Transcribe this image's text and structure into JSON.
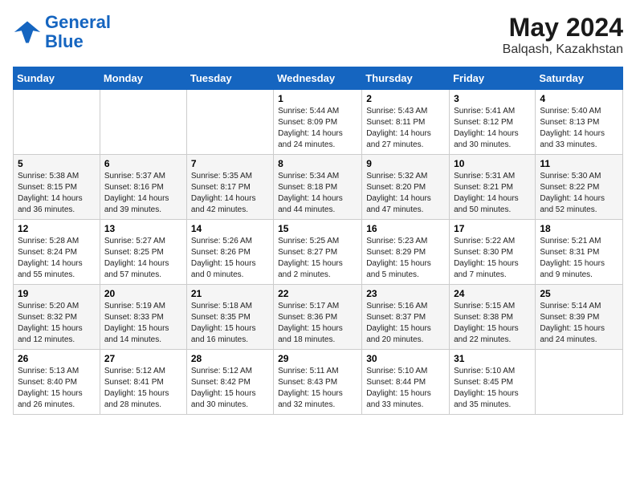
{
  "logo": {
    "line1": "General",
    "line2": "Blue"
  },
  "header": {
    "month_year": "May 2024",
    "location": "Balqash, Kazakhstan"
  },
  "days_of_week": [
    "Sunday",
    "Monday",
    "Tuesday",
    "Wednesday",
    "Thursday",
    "Friday",
    "Saturday"
  ],
  "weeks": [
    [
      {
        "day": "",
        "info": ""
      },
      {
        "day": "",
        "info": ""
      },
      {
        "day": "",
        "info": ""
      },
      {
        "day": "1",
        "info": "Sunrise: 5:44 AM\nSunset: 8:09 PM\nDaylight: 14 hours\nand 24 minutes."
      },
      {
        "day": "2",
        "info": "Sunrise: 5:43 AM\nSunset: 8:11 PM\nDaylight: 14 hours\nand 27 minutes."
      },
      {
        "day": "3",
        "info": "Sunrise: 5:41 AM\nSunset: 8:12 PM\nDaylight: 14 hours\nand 30 minutes."
      },
      {
        "day": "4",
        "info": "Sunrise: 5:40 AM\nSunset: 8:13 PM\nDaylight: 14 hours\nand 33 minutes."
      }
    ],
    [
      {
        "day": "5",
        "info": "Sunrise: 5:38 AM\nSunset: 8:15 PM\nDaylight: 14 hours\nand 36 minutes."
      },
      {
        "day": "6",
        "info": "Sunrise: 5:37 AM\nSunset: 8:16 PM\nDaylight: 14 hours\nand 39 minutes."
      },
      {
        "day": "7",
        "info": "Sunrise: 5:35 AM\nSunset: 8:17 PM\nDaylight: 14 hours\nand 42 minutes."
      },
      {
        "day": "8",
        "info": "Sunrise: 5:34 AM\nSunset: 8:18 PM\nDaylight: 14 hours\nand 44 minutes."
      },
      {
        "day": "9",
        "info": "Sunrise: 5:32 AM\nSunset: 8:20 PM\nDaylight: 14 hours\nand 47 minutes."
      },
      {
        "day": "10",
        "info": "Sunrise: 5:31 AM\nSunset: 8:21 PM\nDaylight: 14 hours\nand 50 minutes."
      },
      {
        "day": "11",
        "info": "Sunrise: 5:30 AM\nSunset: 8:22 PM\nDaylight: 14 hours\nand 52 minutes."
      }
    ],
    [
      {
        "day": "12",
        "info": "Sunrise: 5:28 AM\nSunset: 8:24 PM\nDaylight: 14 hours\nand 55 minutes."
      },
      {
        "day": "13",
        "info": "Sunrise: 5:27 AM\nSunset: 8:25 PM\nDaylight: 14 hours\nand 57 minutes."
      },
      {
        "day": "14",
        "info": "Sunrise: 5:26 AM\nSunset: 8:26 PM\nDaylight: 15 hours\nand 0 minutes."
      },
      {
        "day": "15",
        "info": "Sunrise: 5:25 AM\nSunset: 8:27 PM\nDaylight: 15 hours\nand 2 minutes."
      },
      {
        "day": "16",
        "info": "Sunrise: 5:23 AM\nSunset: 8:29 PM\nDaylight: 15 hours\nand 5 minutes."
      },
      {
        "day": "17",
        "info": "Sunrise: 5:22 AM\nSunset: 8:30 PM\nDaylight: 15 hours\nand 7 minutes."
      },
      {
        "day": "18",
        "info": "Sunrise: 5:21 AM\nSunset: 8:31 PM\nDaylight: 15 hours\nand 9 minutes."
      }
    ],
    [
      {
        "day": "19",
        "info": "Sunrise: 5:20 AM\nSunset: 8:32 PM\nDaylight: 15 hours\nand 12 minutes."
      },
      {
        "day": "20",
        "info": "Sunrise: 5:19 AM\nSunset: 8:33 PM\nDaylight: 15 hours\nand 14 minutes."
      },
      {
        "day": "21",
        "info": "Sunrise: 5:18 AM\nSunset: 8:35 PM\nDaylight: 15 hours\nand 16 minutes."
      },
      {
        "day": "22",
        "info": "Sunrise: 5:17 AM\nSunset: 8:36 PM\nDaylight: 15 hours\nand 18 minutes."
      },
      {
        "day": "23",
        "info": "Sunrise: 5:16 AM\nSunset: 8:37 PM\nDaylight: 15 hours\nand 20 minutes."
      },
      {
        "day": "24",
        "info": "Sunrise: 5:15 AM\nSunset: 8:38 PM\nDaylight: 15 hours\nand 22 minutes."
      },
      {
        "day": "25",
        "info": "Sunrise: 5:14 AM\nSunset: 8:39 PM\nDaylight: 15 hours\nand 24 minutes."
      }
    ],
    [
      {
        "day": "26",
        "info": "Sunrise: 5:13 AM\nSunset: 8:40 PM\nDaylight: 15 hours\nand 26 minutes."
      },
      {
        "day": "27",
        "info": "Sunrise: 5:12 AM\nSunset: 8:41 PM\nDaylight: 15 hours\nand 28 minutes."
      },
      {
        "day": "28",
        "info": "Sunrise: 5:12 AM\nSunset: 8:42 PM\nDaylight: 15 hours\nand 30 minutes."
      },
      {
        "day": "29",
        "info": "Sunrise: 5:11 AM\nSunset: 8:43 PM\nDaylight: 15 hours\nand 32 minutes."
      },
      {
        "day": "30",
        "info": "Sunrise: 5:10 AM\nSunset: 8:44 PM\nDaylight: 15 hours\nand 33 minutes."
      },
      {
        "day": "31",
        "info": "Sunrise: 5:10 AM\nSunset: 8:45 PM\nDaylight: 15 hours\nand 35 minutes."
      },
      {
        "day": "",
        "info": ""
      }
    ]
  ]
}
